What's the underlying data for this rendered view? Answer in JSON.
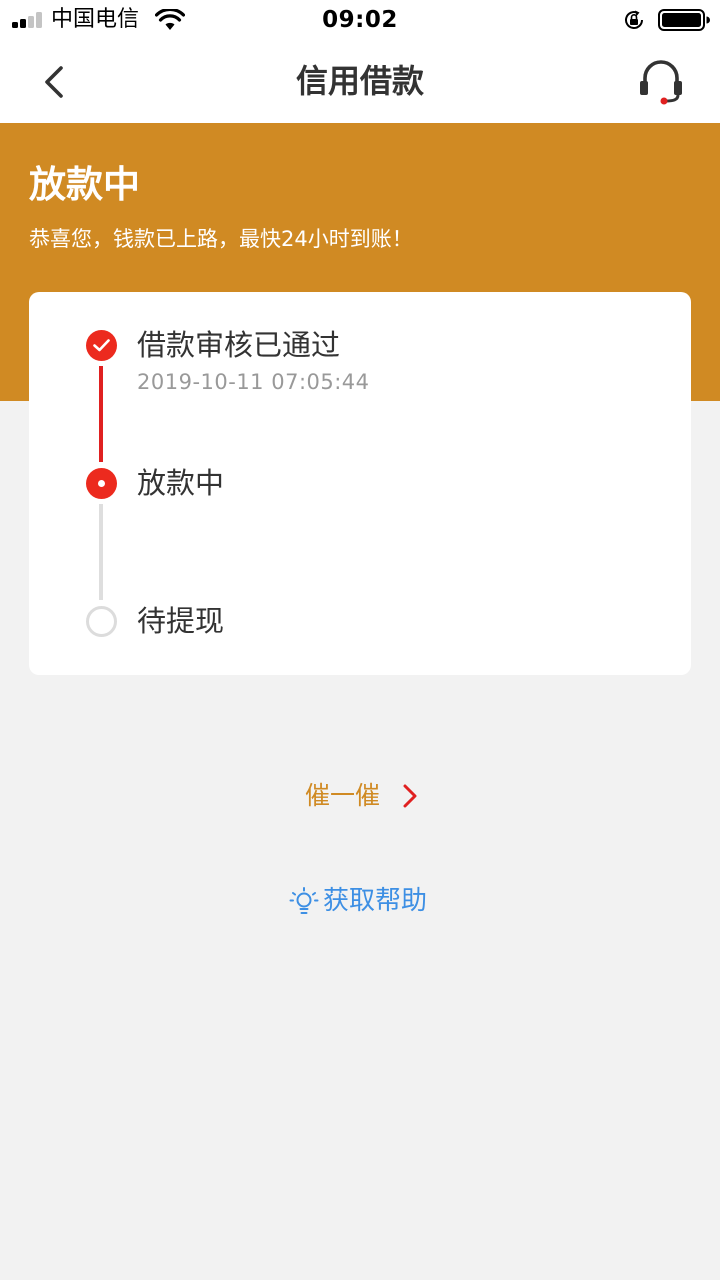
{
  "status_bar": {
    "carrier": "中国电信",
    "time": "09:02"
  },
  "nav": {
    "title": "信用借款",
    "back_icon": "chevron-left-icon",
    "service_icon": "headset-icon"
  },
  "banner": {
    "title": "放款中",
    "subtitle": "恭喜您，钱款已上路，最快24小时到账！"
  },
  "steps": [
    {
      "label": "借款审核已通过",
      "time": "2019-10-11 07:05:44",
      "state": "done"
    },
    {
      "label": "放款中",
      "state": "current"
    },
    {
      "label": "待提现",
      "state": "pending"
    }
  ],
  "actions": {
    "urge_label": "催一催",
    "help_label": "获取帮助"
  },
  "colors": {
    "banner": "#d08a23",
    "accent_red": "#ec2a1e",
    "link_blue": "#3d8fe4",
    "urge_orange": "#d08a23"
  }
}
